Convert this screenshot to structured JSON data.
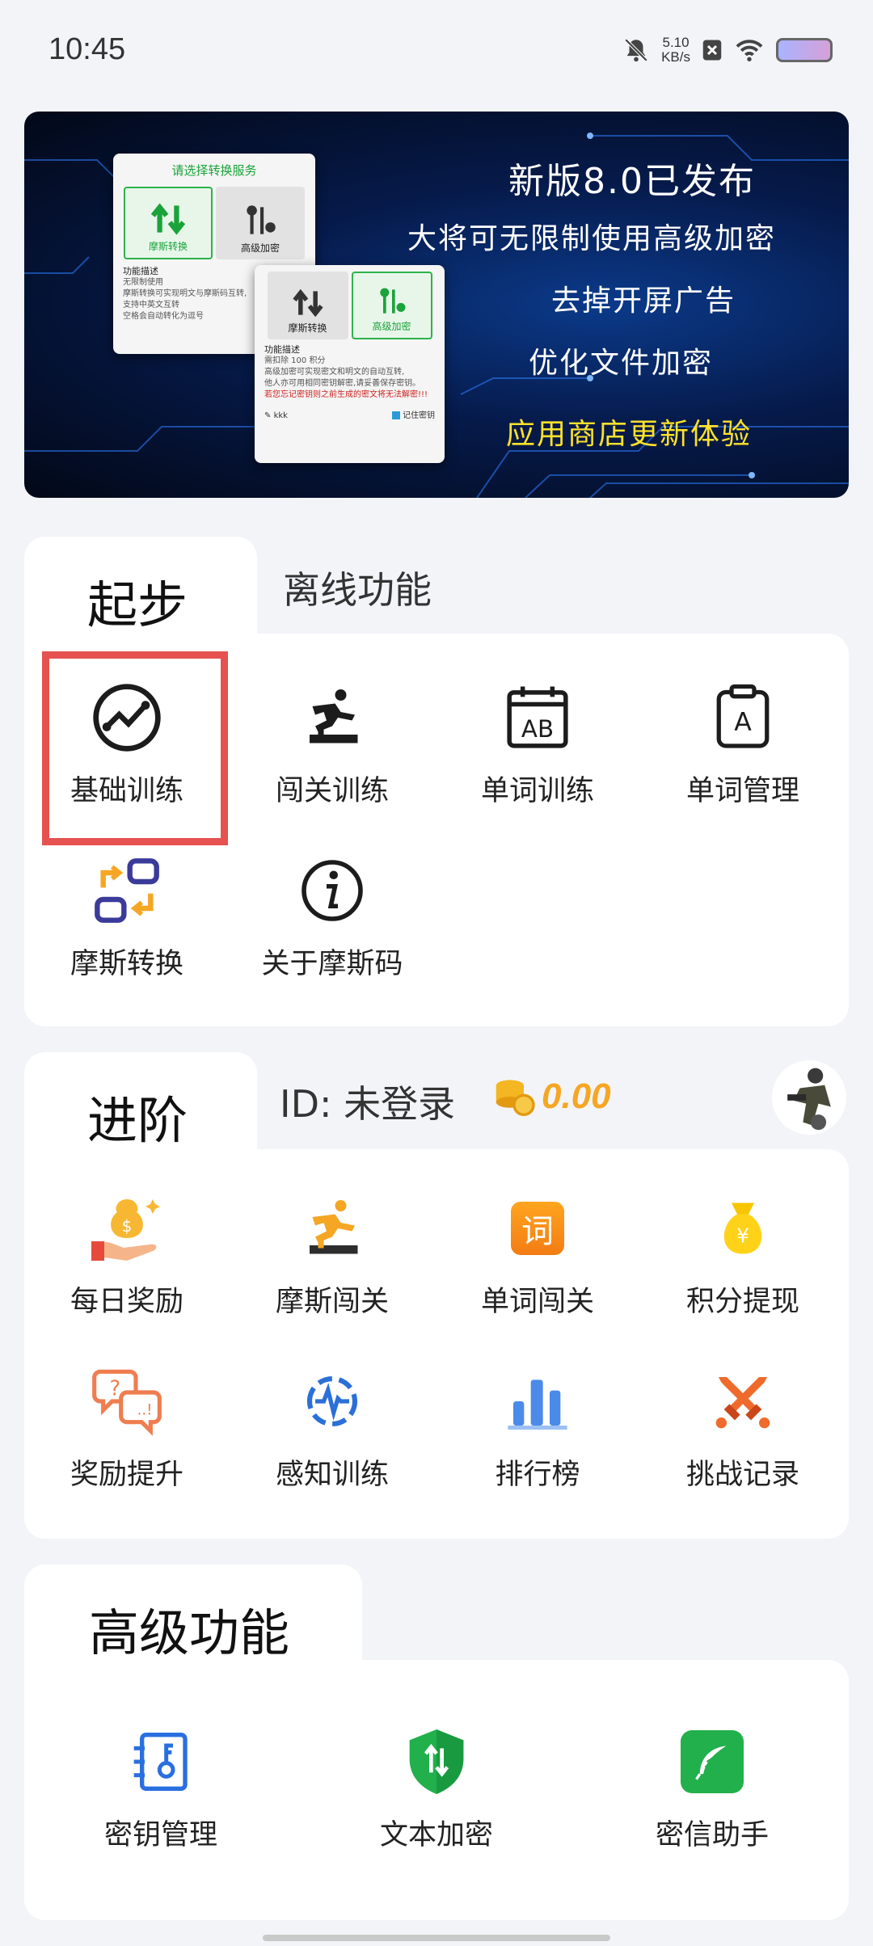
{
  "status_bar": {
    "time": "10:45",
    "net_speed_value": "5.10",
    "net_speed_unit": "KB/s",
    "icons": [
      "mute-icon",
      "close-box-icon",
      "wifi-icon",
      "battery-icon"
    ]
  },
  "banner": {
    "card1": {
      "title": "请选择转换服务",
      "opt_morse": "摩斯转换",
      "opt_encrypt": "高级加密",
      "desc_title": "功能描述",
      "desc_lines": [
        "无限制使用",
        "摩斯转换可实现明文与摩斯码互转,",
        "支持中英文互转",
        "空格会自动转化为逗号"
      ]
    },
    "card2": {
      "opt_morse": "摩斯转换",
      "opt_encrypt": "高级加密",
      "desc_title": "功能描述",
      "desc_lines": [
        "需扣除 100 积分",
        "高级加密可实现密文和明文的自动互转,",
        "他人亦可用相同密钥解密,请妥善保存密钥。"
      ],
      "warning": "若您忘记密钥则之前生成的密文将无法解密!!!",
      "footer_user": "kkk",
      "footer_remember": "记住密钥"
    },
    "lines": [
      "新版8.0已发布",
      "大将可无限制使用高级加密",
      "去掉开屏广告",
      "优化文件加密"
    ],
    "highlight_line": "应用商店更新体验"
  },
  "section_start": {
    "tab_active": "起步",
    "tab_inactive": "离线功能",
    "items": [
      {
        "label": "基础训练",
        "icon": "trend-chart-icon"
      },
      {
        "label": "闯关训练",
        "icon": "hurdle-runner-icon"
      },
      {
        "label": "单词训练",
        "icon": "ab-calendar-icon"
      },
      {
        "label": "单词管理",
        "icon": "clipboard-a-icon"
      },
      {
        "label": "摩斯转换",
        "icon": "swap-convert-icon"
      },
      {
        "label": "关于摩斯码",
        "icon": "info-icon"
      }
    ]
  },
  "section_advanced": {
    "tab_active": "进阶",
    "id_text": "ID: 未登录",
    "coins": "0.00",
    "items": [
      {
        "label": "每日奖励",
        "icon": "daily-reward-icon"
      },
      {
        "label": "摩斯闯关",
        "icon": "morse-challenge-icon"
      },
      {
        "label": "单词闯关",
        "icon": "word-challenge-icon"
      },
      {
        "label": "积分提现",
        "icon": "money-bag-icon"
      },
      {
        "label": "奖励提升",
        "icon": "question-chat-icon"
      },
      {
        "label": "感知训练",
        "icon": "pulse-icon"
      },
      {
        "label": "排行榜",
        "icon": "bar-chart-icon"
      },
      {
        "label": "挑战记录",
        "icon": "crossed-swords-icon"
      }
    ]
  },
  "section_premium": {
    "tab_active": "高级功能",
    "word_challenge_glyph": "词",
    "items": [
      {
        "label": "密钥管理",
        "icon": "key-manage-icon"
      },
      {
        "label": "文本加密",
        "icon": "shield-icon"
      },
      {
        "label": "密信助手",
        "icon": "feather-icon"
      }
    ]
  },
  "colors": {
    "accent_orange": "#f5a623",
    "highlight_red": "#e5524f",
    "premium_blue": "#2a6fe0",
    "premium_green": "#21b04b"
  }
}
